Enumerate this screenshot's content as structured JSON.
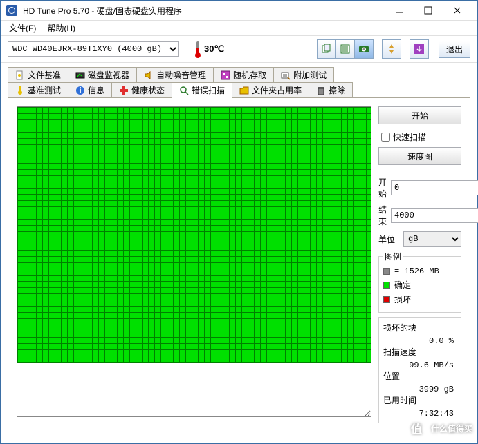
{
  "window": {
    "title": "HD Tune Pro 5.70 - 硬盘/固态硬盘实用程序"
  },
  "menu": {
    "file": "文件(F)",
    "help": "帮助(H)"
  },
  "toolbar": {
    "drive": "WDC WD40EJRX-89T1XY0 (4000 gB)",
    "temperature": "30℃",
    "exit_label": "退出"
  },
  "tabs": {
    "row1": [
      {
        "label": "文件基准"
      },
      {
        "label": "磁盘监视器"
      },
      {
        "label": "自动噪音管理"
      },
      {
        "label": "随机存取"
      },
      {
        "label": "附加测试"
      }
    ],
    "row2": [
      {
        "label": "基准测试"
      },
      {
        "label": "信息"
      },
      {
        "label": "健康状态"
      },
      {
        "label": "错误扫描",
        "active": true
      },
      {
        "label": "文件夹占用率"
      },
      {
        "label": "擦除"
      }
    ]
  },
  "controls": {
    "start": "开始",
    "quick_scan": "快速扫描",
    "speed_map": "速度图",
    "start_label": "开始",
    "start_value": "0",
    "end_label": "结束",
    "end_value": "4000",
    "unit_label": "单位",
    "unit_value": "gB"
  },
  "legend": {
    "title": "图例",
    "block_size": "= 1526 MB",
    "ok": "确定",
    "damaged": "损坏"
  },
  "stats": {
    "damaged_blocks_label": "损坏的块",
    "damaged_blocks_value": "0.0 %",
    "scan_speed_label": "扫描速度",
    "scan_speed_value": "99.6 MB/s",
    "position_label": "位置",
    "position_value": "3999 gB",
    "elapsed_label": "已用时间",
    "elapsed_value": "7:32:43"
  },
  "watermark": {
    "logo": "值",
    "text": "什么值得买"
  }
}
